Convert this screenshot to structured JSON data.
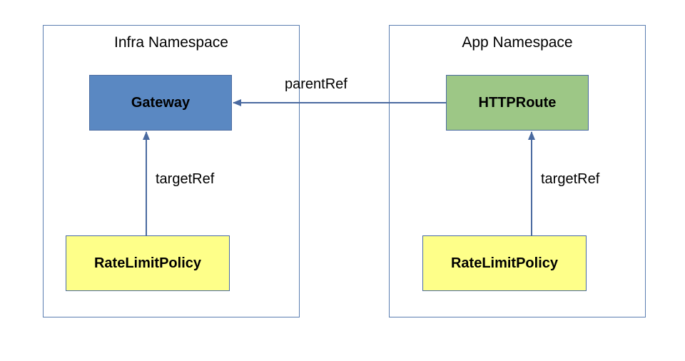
{
  "diagram": {
    "namespaces": {
      "infra": {
        "title": "Infra Namespace"
      },
      "app": {
        "title": "App Namespace"
      }
    },
    "nodes": {
      "gateway": {
        "label": "Gateway"
      },
      "httproute": {
        "label": "HTTPRoute"
      },
      "rlp_infra": {
        "label": "RateLimitPolicy"
      },
      "rlp_app": {
        "label": "RateLimitPolicy"
      }
    },
    "edges": {
      "parentRef": {
        "label": "parentRef"
      },
      "targetRef_infra": {
        "label": "targetRef"
      },
      "targetRef_app": {
        "label": "targetRef"
      }
    },
    "colors": {
      "border": "#4a6aa0",
      "blue": "#5a88c2",
      "green": "#9dc786",
      "yellow": "#feff89",
      "arrow": "#4a6aa0"
    }
  }
}
